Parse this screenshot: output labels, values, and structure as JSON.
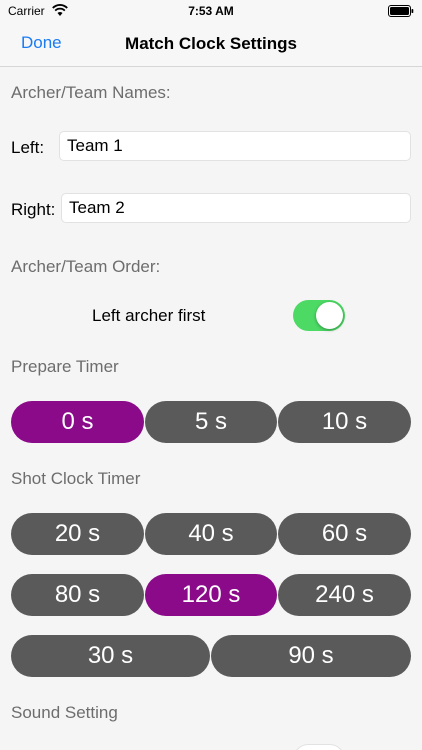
{
  "status_bar": {
    "carrier": "Carrier",
    "time": "7:53 AM"
  },
  "nav": {
    "done_label": "Done",
    "title": "Match Clock Settings"
  },
  "names": {
    "section_label": "Archer/Team Names:",
    "left_label": "Left:",
    "left_value": "Team 1",
    "right_label": "Right:",
    "right_value": "Team 2"
  },
  "order": {
    "section_label": "Archer/Team Order:",
    "toggle_label": "Left archer first",
    "toggle_on": true
  },
  "prepare_timer": {
    "section_label": "Prepare Timer",
    "options": [
      "0 s",
      "5 s",
      "10 s"
    ],
    "selected": "0 s"
  },
  "shot_clock": {
    "section_label": "Shot Clock Timer",
    "options": [
      "20 s",
      "40 s",
      "60 s",
      "80 s",
      "120 s",
      "240 s",
      "30 s",
      "90 s"
    ],
    "selected": "120 s"
  },
  "sound": {
    "section_label": "Sound Setting"
  },
  "colors": {
    "accent_blue": "#1a7cf5",
    "selected_purple": "#8a0a8a",
    "unselected_gray": "#5a5a5a",
    "toggle_green": "#4cd964"
  }
}
